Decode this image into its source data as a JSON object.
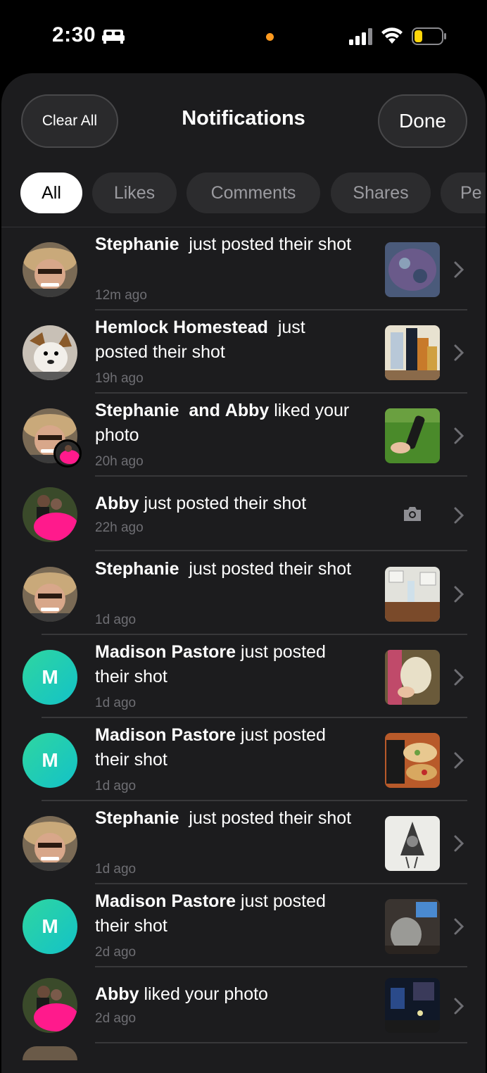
{
  "status": {
    "time": "2:30"
  },
  "header": {
    "clear_label": "Clear All",
    "title": "Notifications",
    "done_label": "Done"
  },
  "tabs": [
    {
      "label": "All",
      "active": true
    },
    {
      "label": "Likes",
      "active": false
    },
    {
      "label": "Comments",
      "active": false
    },
    {
      "label": "Shares",
      "active": false
    },
    {
      "label": "Pe",
      "active": false
    }
  ],
  "notifications": [
    {
      "name": "Stephanie",
      "action": "just posted their shot",
      "time": "12m ago",
      "avatar": "photo-stephanie",
      "thumb": "photo"
    },
    {
      "name": "Hemlock Homestead",
      "action": "just posted their shot",
      "time": "19h ago",
      "avatar": "photo-dog",
      "thumb": "photo"
    },
    {
      "name": "Stephanie",
      "and": "and",
      "name2": "Abby",
      "action": "liked your photo",
      "time": "20h ago",
      "avatar": "photo-stephanie",
      "thumb": "photo"
    },
    {
      "name": "Abby",
      "action": "just posted their shot",
      "time": "22h ago",
      "avatar": "photo-abby",
      "thumb": "camera-icon"
    },
    {
      "name": "Stephanie",
      "action": "just posted their shot",
      "time": "1d ago",
      "avatar": "photo-stephanie",
      "thumb": "photo"
    },
    {
      "name": "Madison Pastore",
      "action": "just posted their shot",
      "time": "1d ago",
      "avatar": "M",
      "thumb": "photo"
    },
    {
      "name": "Madison Pastore",
      "action": "just posted their shot",
      "time": "1d ago",
      "avatar": "M",
      "thumb": "photo"
    },
    {
      "name": "Stephanie",
      "action": "just posted their shot",
      "time": "1d ago",
      "avatar": "photo-stephanie",
      "thumb": "photo"
    },
    {
      "name": "Madison Pastore",
      "action": "just posted their shot",
      "time": "2d ago",
      "avatar": "M",
      "thumb": "photo"
    },
    {
      "name": "Abby",
      "action": "liked your photo",
      "time": "2d ago",
      "avatar": "photo-abby",
      "thumb": "photo"
    }
  ],
  "colors": {
    "accent_gradient_start": "#2fd6a0",
    "accent_gradient_end": "#13c2c8",
    "status_dot": "#ff9a1f",
    "battery": "#ffd60a"
  }
}
